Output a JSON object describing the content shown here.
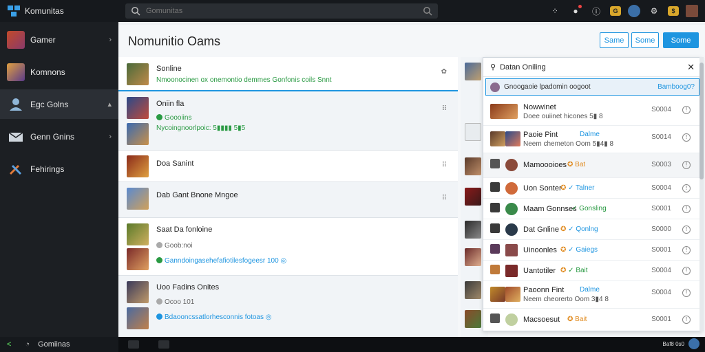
{
  "app": {
    "title": "Komunitas"
  },
  "search": {
    "placeholder": "Gomunitas"
  },
  "sidebar": {
    "items": [
      {
        "label": "Gamer",
        "icon": "game-avatar-icon",
        "chevron": "›"
      },
      {
        "label": "Komnons",
        "icon": "sword-icon",
        "chevron": ""
      },
      {
        "label": "Egc Golns",
        "icon": "user-icon",
        "chevron": "▴"
      },
      {
        "label": "Genn Gnins",
        "icon": "mail-icon",
        "chevron": "›"
      },
      {
        "label": "Fehirings",
        "icon": "tools-icon",
        "chevron": ""
      }
    ],
    "bottom_label": "Gomiinas"
  },
  "main": {
    "title": "Nomunitio Oams",
    "buttons": {
      "b1": "Same",
      "b2": "Some",
      "b3": "Some"
    },
    "rows": [
      {
        "title": "Sonline",
        "sub": "Nmoonocinen ox onemontio demmes Gonfonis coils Snnt",
        "meta": "✿"
      },
      {
        "title": "Oniin fla",
        "sub1": "Goooiins",
        "sub2": "Nycoingnoorlpoic: 5▮▮▮▮ 5▮5",
        "meta": "⠿"
      },
      {
        "title": "Doa Sanint",
        "meta": "⠿"
      },
      {
        "title": "Dab Gant Bnone Mngoe",
        "meta": "⠿"
      },
      {
        "title": "Saat Da fonloine",
        "sub1": "Goob:noi",
        "sub2": "Ganndoingasehefafiotilesfogeesr 100 ◎",
        "meta": ""
      },
      {
        "title": "Uoo Fadins Onites",
        "sub1": "Ocoo 101",
        "sub2": "Bdaooncssatlorhesconnis fotoas ◎",
        "meta": ""
      }
    ]
  },
  "popup": {
    "title": "Datan Oniling",
    "search_text": "Gnoogaoie lpadomin oogoot",
    "search_right": "Bamboog0?",
    "rows": [
      {
        "name": "Nowwinet",
        "sub": "Doee ouiinet hicones 5▮ 8",
        "status": "",
        "num": "S0004"
      },
      {
        "name": "Paoie Pint",
        "sub": "Neem chemeton Oom 5▮4▮ 8",
        "status": "Dalme",
        "num": "S0014"
      },
      {
        "name": "Mamoooioes",
        "sub": "",
        "status": "Bat",
        "num": "S0003"
      },
      {
        "name": "Uon Sonter",
        "sub": "",
        "status": "Talner",
        "num": "S0004"
      },
      {
        "name": "Maam Gonnses",
        "sub": "",
        "status": "Gonsling",
        "num": "S0001"
      },
      {
        "name": "Dat Gnline",
        "sub": "",
        "status": "Qonlng",
        "num": "S0000"
      },
      {
        "name": "Uinoonles",
        "sub": "",
        "status": "Gaiegs",
        "num": "S0001"
      },
      {
        "name": "Uantotiler",
        "sub": "",
        "status": "Bait",
        "num": "S0004"
      },
      {
        "name": "Paoonn Fint",
        "sub": "Neem cheorerto Oom 3▮4 8",
        "status": "Dalme",
        "num": "S0004"
      },
      {
        "name": "Macsoesut",
        "sub": "",
        "status": "Bait",
        "num": "S0001"
      }
    ]
  },
  "bottom": {
    "right_text": "Baf8 0s0"
  },
  "colors": {
    "accent": "#1e95e0",
    "online": "#2a9a43",
    "warn": "#e08a1e",
    "dark": "#16191d"
  }
}
